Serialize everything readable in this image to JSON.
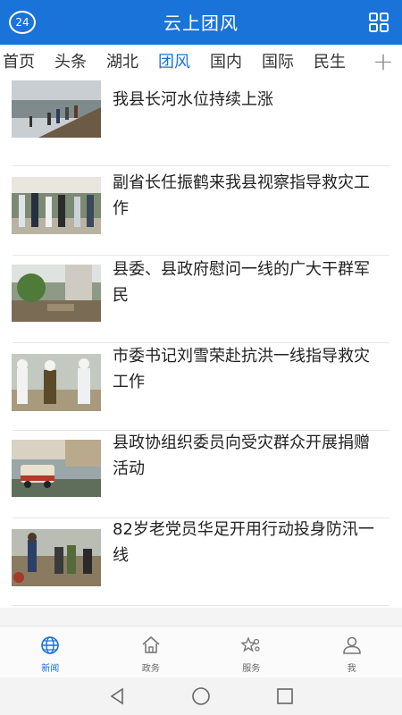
{
  "header": {
    "title": "云上团风",
    "badge": "24"
  },
  "tabs": [
    {
      "label": "首页"
    },
    {
      "label": "头条"
    },
    {
      "label": "湖北"
    },
    {
      "label": "团风",
      "active": true
    },
    {
      "label": "国内"
    },
    {
      "label": "国际"
    },
    {
      "label": "民生"
    }
  ],
  "tab_add_icon": "plus-icon",
  "news": [
    {
      "headline": "我县长河水位持续上涨",
      "thumb": "flood-bank-photo"
    },
    {
      "headline": "副省长任振鹤来我县视察指导救灾工作",
      "thumb": "officials-visit-photo"
    },
    {
      "headline": "县委、县政府慰问一线的广大干群军民",
      "thumb": "debris-street-photo"
    },
    {
      "headline": "市委书记刘雪荣赴抗洪一线指导救灾工作",
      "thumb": "officials-hats-photo"
    },
    {
      "headline": "县政协组织委员向受灾群众开展捐赠活动",
      "thumb": "donation-vehicle-photo"
    },
    {
      "headline": "82岁老党员华足开用行动投身防汛一线",
      "thumb": "sandbag-workers-photo"
    }
  ],
  "bottom_nav": [
    {
      "label": "新闻",
      "icon": "globe-icon",
      "active": true
    },
    {
      "label": "政务",
      "icon": "home-icon"
    },
    {
      "label": "服务",
      "icon": "star-service-icon"
    },
    {
      "label": "我",
      "icon": "user-icon"
    }
  ],
  "system_nav": [
    "back-icon",
    "home-circle-icon",
    "recents-icon"
  ],
  "colors": {
    "accent": "#1a73d9",
    "header_bg": "#1a73d9",
    "text": "#222222"
  }
}
